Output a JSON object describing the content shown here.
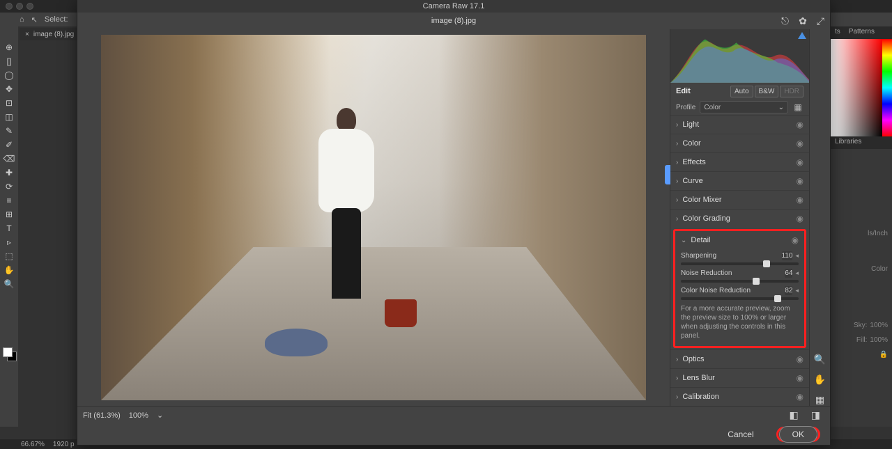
{
  "ps": {
    "options": {
      "home_icon": "⌂",
      "arrow_icon": "↖",
      "select_label": "Select:"
    },
    "tab": {
      "filename": "image (8).jpg",
      "close": "×"
    },
    "tools": [
      "⊕",
      "[]",
      "◯",
      "✥",
      "⊡",
      "◫",
      "✎",
      "✐",
      "⌫",
      "✚",
      "⟳",
      "≡",
      "⊞",
      "T",
      "▹",
      "⬚",
      "✋",
      "🔍"
    ],
    "right_tabs": {
      "a": "ts",
      "b": "Patterns",
      "lib": "Libraries"
    },
    "resolution_unit": "ls/Inch",
    "anti_alias": "Color",
    "sky_label": "Sky:",
    "sky_val": "100%",
    "fill_label": "Fill:",
    "fill_val": "100%",
    "bottom": {
      "zoom": "66.67%",
      "info": "1920 p"
    }
  },
  "cr": {
    "title": "Camera Raw 17.1",
    "filename": "image (8).jpg",
    "header_icons": {
      "export": "⎋",
      "settings": "✿",
      "fullscreen": "⤢"
    },
    "fit": "Fit (61.3%)",
    "zoom": "100%",
    "edit_label": "Edit",
    "auto": "Auto",
    "bw": "B&W",
    "hdr": "HDR",
    "profile_label": "Profile",
    "profile_value": "Color",
    "sections": {
      "light": "Light",
      "color": "Color",
      "effects": "Effects",
      "curve": "Curve",
      "mixer": "Color Mixer",
      "grading": "Color Grading",
      "detail": "Detail",
      "optics": "Optics",
      "lensblur": "Lens Blur",
      "calibration": "Calibration"
    },
    "detail": {
      "sharpening_label": "Sharpening",
      "sharpening_val": "110",
      "nr_label": "Noise Reduction",
      "nr_val": "64",
      "cnr_label": "Color Noise Reduction",
      "cnr_val": "82",
      "hint": "For a more accurate preview, zoom the preview size to 100% or larger when adjusting the controls in this panel."
    },
    "right_tools": {
      "zoom": "🔍",
      "hand": "✋",
      "crop": "▦",
      "grid": "▤"
    },
    "cancel": "Cancel",
    "ok": "OK"
  }
}
